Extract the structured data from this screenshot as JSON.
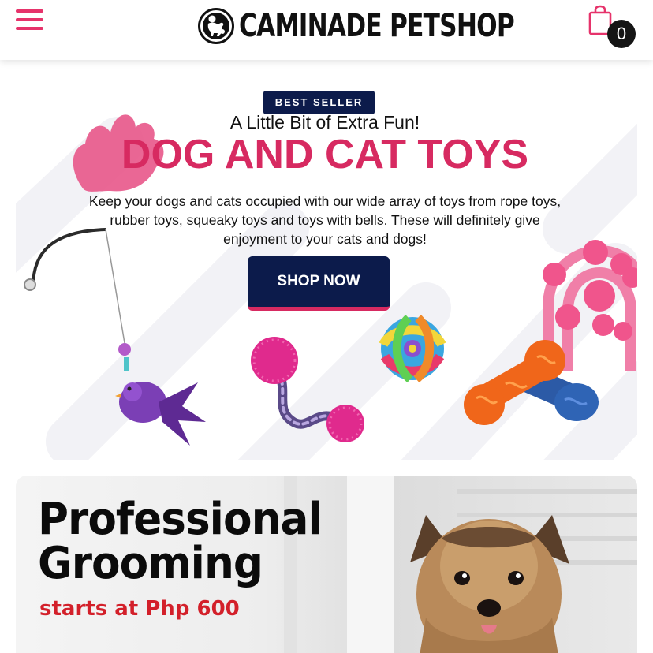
{
  "header": {
    "brand": "CAMINADE PETSHOP",
    "cart_count": "0",
    "colors": {
      "accent": "#e6336b",
      "text": "#111111"
    }
  },
  "hero": {
    "badge": "BEST SELLER",
    "subtitle": "A Little Bit of Extra Fun!",
    "title": "DOG AND CAT TOYS",
    "description": "Keep your dogs and cats occupied with our wide array of toys from rope toys, rubber toys, squeaky toys and toys with bells. These will definitely give enjoyment to your cats and dogs!",
    "cta": "SHOP NOW",
    "colors": {
      "navy": "#0c1b4b",
      "pink": "#d72a61"
    }
  },
  "grooming": {
    "title_line1": "Professional",
    "title_line2": "Grooming",
    "price": "starts at Php 600",
    "colors": {
      "price": "#d3202a"
    }
  },
  "icons": [
    "hamburger-menu-icon",
    "logo-icon",
    "shopping-bag-icon"
  ]
}
